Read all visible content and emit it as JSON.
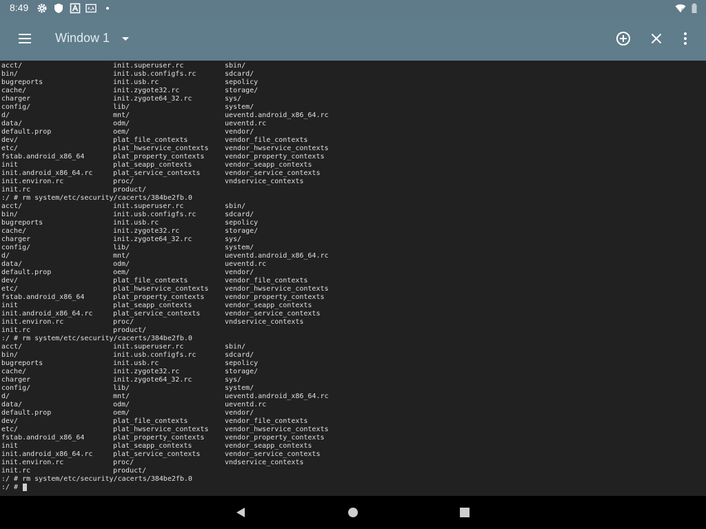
{
  "status_bar": {
    "time": "8:49",
    "icons": [
      "gear-icon",
      "shield-icon",
      "font-icon",
      "keyboard-icon",
      "dot-icon"
    ],
    "right_icons": [
      "wifi-icon",
      "battery-icon"
    ]
  },
  "app_bar": {
    "title": "Window 1",
    "icons": [
      "menu-icon",
      "chevron-down-icon",
      "add-circle-icon",
      "close-icon",
      "more-vert-icon"
    ]
  },
  "terminal": {
    "blocks": [
      {
        "rows": [
          [
            "acct/",
            "init.superuser.rc",
            "sbin/"
          ],
          [
            "bin/",
            "init.usb.configfs.rc",
            "sdcard/"
          ],
          [
            "bugreports",
            "init.usb.rc",
            "sepolicy"
          ],
          [
            "cache/",
            "init.zygote32.rc",
            "storage/"
          ],
          [
            "charger",
            "init.zygote64_32.rc",
            "sys/"
          ],
          [
            "config/",
            "lib/",
            "system/"
          ],
          [
            "d/",
            "mnt/",
            "ueventd.android_x86_64.rc"
          ],
          [
            "data/",
            "odm/",
            "ueventd.rc"
          ],
          [
            "default.prop",
            "oem/",
            "vendor/"
          ],
          [
            "dev/",
            "plat_file_contexts",
            "vendor_file_contexts"
          ],
          [
            "etc/",
            "plat_hwservice_contexts",
            "vendor_hwservice_contexts"
          ],
          [
            "fstab.android_x86_64",
            "plat_property_contexts",
            "vendor_property_contexts"
          ],
          [
            "init",
            "plat_seapp_contexts",
            "vendor_seapp_contexts"
          ],
          [
            "init.android_x86_64.rc",
            "plat_service_contexts",
            "vendor_service_contexts"
          ],
          [
            "init.environ.rc",
            "proc/",
            "vndservice_contexts"
          ],
          [
            "init.rc",
            "product/",
            ""
          ]
        ],
        "command": ":/ # rm system/etc/security/cacerts/384be2fb.0"
      },
      {
        "rows": [
          [
            "acct/",
            "init.superuser.rc",
            "sbin/"
          ],
          [
            "bin/",
            "init.usb.configfs.rc",
            "sdcard/"
          ],
          [
            "bugreports",
            "init.usb.rc",
            "sepolicy"
          ],
          [
            "cache/",
            "init.zygote32.rc",
            "storage/"
          ],
          [
            "charger",
            "init.zygote64_32.rc",
            "sys/"
          ],
          [
            "config/",
            "lib/",
            "system/"
          ],
          [
            "d/",
            "mnt/",
            "ueventd.android_x86_64.rc"
          ],
          [
            "data/",
            "odm/",
            "ueventd.rc"
          ],
          [
            "default.prop",
            "oem/",
            "vendor/"
          ],
          [
            "dev/",
            "plat_file_contexts",
            "vendor_file_contexts"
          ],
          [
            "etc/",
            "plat_hwservice_contexts",
            "vendor_hwservice_contexts"
          ],
          [
            "fstab.android_x86_64",
            "plat_property_contexts",
            "vendor_property_contexts"
          ],
          [
            "init",
            "plat_seapp_contexts",
            "vendor_seapp_contexts"
          ],
          [
            "init.android_x86_64.rc",
            "plat_service_contexts",
            "vendor_service_contexts"
          ],
          [
            "init.environ.rc",
            "proc/",
            "vndservice_contexts"
          ],
          [
            "init.rc",
            "product/",
            ""
          ]
        ],
        "command": ":/ # rm system/etc/security/cacerts/384be2fb.0"
      },
      {
        "rows": [
          [
            "acct/",
            "init.superuser.rc",
            "sbin/"
          ],
          [
            "bin/",
            "init.usb.configfs.rc",
            "sdcard/"
          ],
          [
            "bugreports",
            "init.usb.rc",
            "sepolicy"
          ],
          [
            "cache/",
            "init.zygote32.rc",
            "storage/"
          ],
          [
            "charger",
            "init.zygote64_32.rc",
            "sys/"
          ],
          [
            "config/",
            "lib/",
            "system/"
          ],
          [
            "d/",
            "mnt/",
            "ueventd.android_x86_64.rc"
          ],
          [
            "data/",
            "odm/",
            "ueventd.rc"
          ],
          [
            "default.prop",
            "oem/",
            "vendor/"
          ],
          [
            "dev/",
            "plat_file_contexts",
            "vendor_file_contexts"
          ],
          [
            "etc/",
            "plat_hwservice_contexts",
            "vendor_hwservice_contexts"
          ],
          [
            "fstab.android_x86_64",
            "plat_property_contexts",
            "vendor_property_contexts"
          ],
          [
            "init",
            "plat_seapp_contexts",
            "vendor_seapp_contexts"
          ],
          [
            "init.android_x86_64.rc",
            "plat_service_contexts",
            "vendor_service_contexts"
          ],
          [
            "init.environ.rc",
            "proc/",
            "vndservice_contexts"
          ],
          [
            "init.rc",
            "product/",
            ""
          ]
        ],
        "command": ":/ # rm system/etc/security/cacerts/384be2fb.0"
      }
    ],
    "prompt": ":/ # "
  },
  "nav_bar": {
    "icons": [
      "back-icon",
      "home-icon",
      "recents-icon"
    ]
  },
  "colors": {
    "status_bar": "#5f7a89",
    "app_bar": "#607d8b",
    "terminal_bg": "#212121",
    "terminal_text": "#e0e0e0",
    "nav_bar": "#000000"
  }
}
